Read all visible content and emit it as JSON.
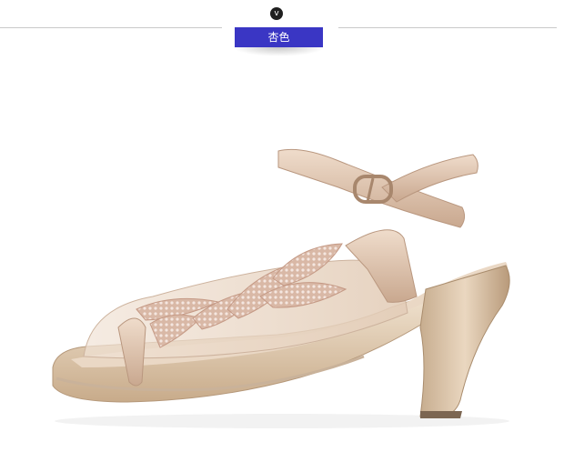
{
  "color_tab": {
    "label": "杏色",
    "background": "#3a36c4"
  },
  "badge": {
    "glyph": "v",
    "icon": "chevron-down-icon"
  }
}
